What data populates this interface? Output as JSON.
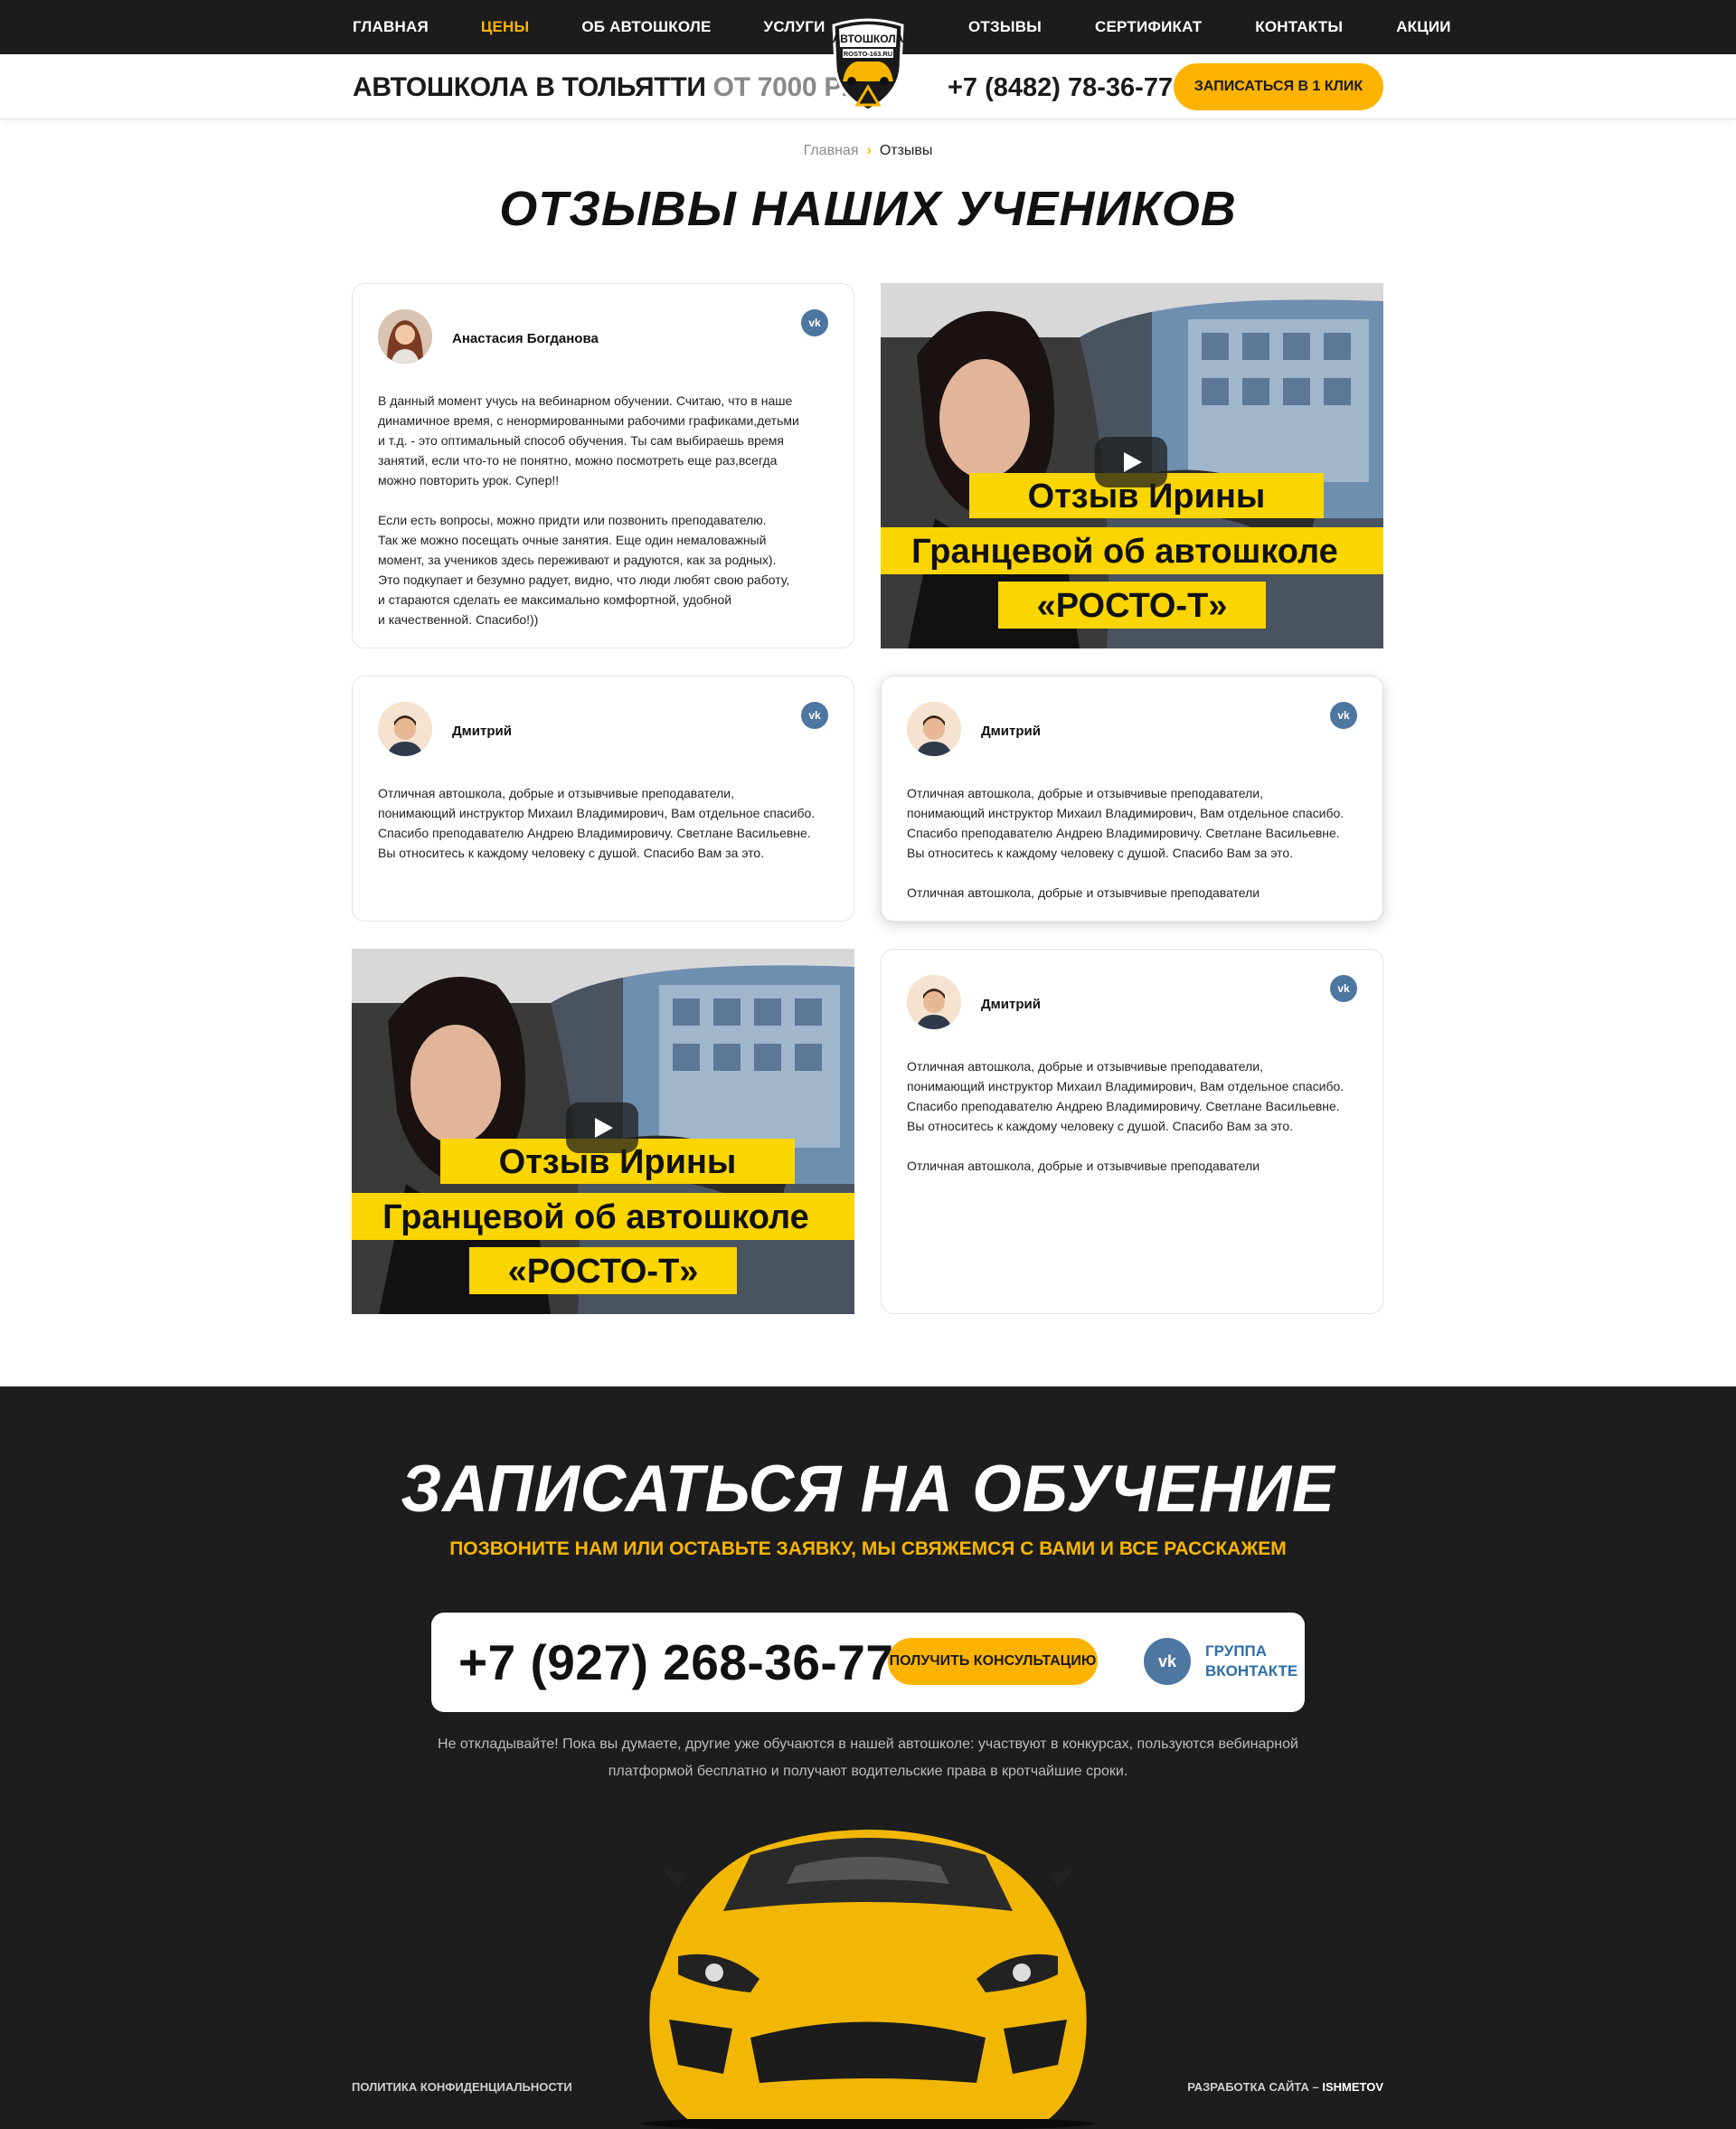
{
  "nav": {
    "left": [
      "Главная",
      "Цены",
      "Об автошколе",
      "Услуги"
    ],
    "right": [
      "Отзывы",
      "Сертификат",
      "Контакты",
      "Акции"
    ],
    "active": "Цены"
  },
  "logo": {
    "top_text": "АВТОШКОЛА",
    "url_text": "ROSTO-163.RU"
  },
  "header": {
    "title": "АВТОШКОЛА В ТОЛЬЯТТИ",
    "price": "ОТ 7000 РУБ.",
    "phone": "+7 (8482) 78-36-77",
    "cta": "Записаться в 1 клик"
  },
  "breadcrumbs": {
    "home": "Главная",
    "current": "Отзывы"
  },
  "page_title": "Отзывы наших учеников",
  "reviews": [
    {
      "author": "Анастасия Богданова",
      "text": "В данный момент учусь на вебинарном обучении. Считаю, что в наше\nдинамичное время, с ненормированными рабочими графиками,детьми\nи т.д. - это оптимальный способ обучения. Ты сам выбираешь время\nзанятий, если что-то не понятно, можно посмотреть еще раз,всегда\nможно повторить урок. Супер!!\n\nЕсли есть вопросы, можно придти или позвонить преподавателю.\nТак же можно посещать очные занятия. Еще один немаловажный\nмомент, за учеников здесь переживают и радуются, как за родных).\nЭто подкупает и безумно радует, видно, что люди любят свою работу,\nи стараются сделать ее максимально комфортной, удобной\nи качественной. Спасибо!))"
    },
    {
      "author": "Дмитрий",
      "text": "Отличная автошкола, добрые и отзывчивые преподаватели,\nпонимающий инструктор Михаил Владимирович, Вам отдельное спасибо.\nСпасибо преподавателю Андрею Владимировичу. Светлане Васильевне.\nВы относитесь к каждому человеку с душой. Спасибо Вам за это."
    },
    {
      "author": "Дмитрий",
      "text": "Отличная автошкола, добрые и отзывчивые преподаватели,\nпонимающий инструктор Михаил Владимирович, Вам отдельное спасибо.\nСпасибо преподавателю Андрею Владимировичу. Светлане Васильевне.\nВы относитесь к каждому человеку с душой. Спасибо Вам за это.\n\nОтличная автошкола, добрые и отзывчивые преподаватели"
    },
    {
      "author": "Дмитрий",
      "text": "Отличная автошкола, добрые и отзывчивые преподаватели,\nпонимающий инструктор Михаил Владимирович, Вам отдельное спасибо.\nСпасибо преподавателю Андрею Владимировичу. Светлане Васильевне.\nВы относитесь к каждому человеку с душой. Спасибо Вам за это.\n\nОтличная автошкола, добрые и отзывчивые преподаватели"
    }
  ],
  "video": {
    "line1": "Отзыв Ирины",
    "line2": "Гранцевой об автошколе",
    "line3": "«РОСТО-Т»"
  },
  "signup": {
    "title": "Записаться на обучение",
    "subtitle": "Позвоните нам или оставьте заявку, мы свяжемся с вами и все расскажем",
    "phone": "+7 (927) 268-36-77",
    "consult": "Получить консультацию",
    "vk_line1": "Группа",
    "vk_line2": "Вконтакте",
    "note": "Не откладывайте! Пока вы думаете, другие уже обучаются в нашей автошколе: участвуют в конкурсах, пользуются вебинарной платформой бесплатно и получают водительские права в кротчайшие сроки."
  },
  "footer": {
    "policy": "Политика конфиденциальности",
    "dev_prefix": "Разработка сайта –",
    "dev_name": "ISHMETOV"
  },
  "colors": {
    "accent": "#f7b500",
    "dark": "#1d1d1d",
    "vk": "#4d76a1"
  }
}
